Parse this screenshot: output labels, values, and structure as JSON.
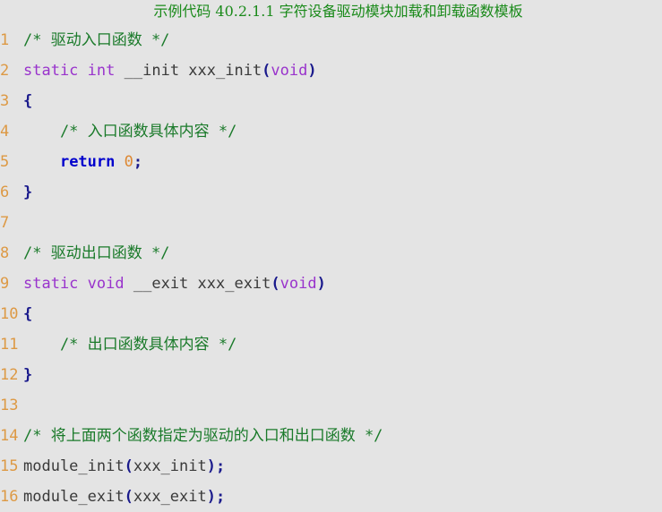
{
  "caption": "示例代码 40.2.1.1  字符设备驱动模块加载和卸载函数模板",
  "colors": {
    "background": "#e4e4e4",
    "caption": "#1a8a1a",
    "line_number": "#dd9944",
    "comment": "#1a7a2a",
    "type_keyword": "#9933cc",
    "control_keyword": "#0000cd",
    "identifier": "#3a3a3a",
    "punctuation": "#1a1a8c",
    "number": "#dd8833"
  },
  "lines": [
    {
      "number": "1",
      "text": "/* 驱动入口函数 */",
      "tokens": [
        {
          "t": "/* 驱动入口函数 */",
          "c": "cm"
        }
      ]
    },
    {
      "number": "2",
      "text": "static int __init xxx_init(void)",
      "tokens": [
        {
          "t": "static",
          "c": "kw"
        },
        {
          "t": " ",
          "c": "id"
        },
        {
          "t": "int",
          "c": "kw"
        },
        {
          "t": " ",
          "c": "id"
        },
        {
          "t": "__init xxx_init",
          "c": "id"
        },
        {
          "t": "(",
          "c": "pn"
        },
        {
          "t": "void",
          "c": "kw"
        },
        {
          "t": ")",
          "c": "pn"
        }
      ]
    },
    {
      "number": "3",
      "text": "{",
      "tokens": [
        {
          "t": "{",
          "c": "pn"
        }
      ]
    },
    {
      "number": "4",
      "text": "    /* 入口函数具体内容 */",
      "tokens": [
        {
          "t": "    /* 入口函数具体内容 */",
          "c": "cm"
        }
      ]
    },
    {
      "number": "5",
      "text": "    return 0;",
      "tokens": [
        {
          "t": "    ",
          "c": "id"
        },
        {
          "t": "return",
          "c": "kw2"
        },
        {
          "t": " ",
          "c": "id"
        },
        {
          "t": "0",
          "c": "num"
        },
        {
          "t": ";",
          "c": "pn"
        }
      ]
    },
    {
      "number": "6",
      "text": "}",
      "tokens": [
        {
          "t": "}",
          "c": "pn"
        }
      ]
    },
    {
      "number": "7",
      "text": "",
      "tokens": []
    },
    {
      "number": "8",
      "text": "/* 驱动出口函数 */",
      "tokens": [
        {
          "t": "/* 驱动出口函数 */",
          "c": "cm"
        }
      ]
    },
    {
      "number": "9",
      "text": "static void __exit xxx_exit(void)",
      "tokens": [
        {
          "t": "static",
          "c": "kw"
        },
        {
          "t": " ",
          "c": "id"
        },
        {
          "t": "void",
          "c": "kw"
        },
        {
          "t": " ",
          "c": "id"
        },
        {
          "t": "__exit xxx_exit",
          "c": "id"
        },
        {
          "t": "(",
          "c": "pn"
        },
        {
          "t": "void",
          "c": "kw"
        },
        {
          "t": ")",
          "c": "pn"
        }
      ]
    },
    {
      "number": "10",
      "text": "{",
      "tokens": [
        {
          "t": "{",
          "c": "pn"
        }
      ]
    },
    {
      "number": "11",
      "text": "    /* 出口函数具体内容 */",
      "tokens": [
        {
          "t": "    /* 出口函数具体内容 */",
          "c": "cm"
        }
      ]
    },
    {
      "number": "12",
      "text": "}",
      "tokens": [
        {
          "t": "}",
          "c": "pn"
        }
      ]
    },
    {
      "number": "13",
      "text": "",
      "tokens": []
    },
    {
      "number": "14",
      "text": "/* 将上面两个函数指定为驱动的入口和出口函数 */",
      "tokens": [
        {
          "t": "/* 将上面两个函数指定为驱动的入口和出口函数 */",
          "c": "cm"
        }
      ]
    },
    {
      "number": "15",
      "text": "module_init(xxx_init);",
      "tokens": [
        {
          "t": "module_init",
          "c": "id"
        },
        {
          "t": "(",
          "c": "pn"
        },
        {
          "t": "xxx_init",
          "c": "id"
        },
        {
          "t": ")",
          "c": "pn"
        },
        {
          "t": ";",
          "c": "pn"
        }
      ]
    },
    {
      "number": "16",
      "text": "module_exit(xxx_exit);",
      "tokens": [
        {
          "t": "module_exit",
          "c": "id"
        },
        {
          "t": "(",
          "c": "pn"
        },
        {
          "t": "xxx_exit",
          "c": "id"
        },
        {
          "t": ")",
          "c": "pn"
        },
        {
          "t": ";",
          "c": "pn"
        }
      ]
    }
  ]
}
